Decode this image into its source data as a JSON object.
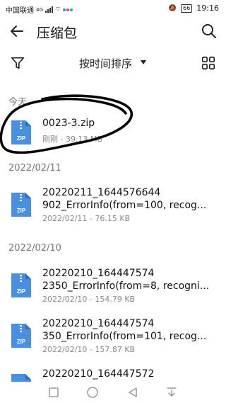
{
  "status_bar": {
    "carrier": "中国联通",
    "network": "4G",
    "battery": "66",
    "time": "19:16"
  },
  "app_bar": {
    "title": "压缩包",
    "back_icon": "back-arrow-icon",
    "search_icon": "search-icon"
  },
  "sort_bar": {
    "sort_label": "按时间排序",
    "filter_icon": "filter-icon",
    "grid_icon": "grid-view-icon"
  },
  "sections": [
    {
      "header": "今天",
      "files": [
        {
          "name_line1": "0023-3.zip",
          "name_line2": "",
          "meta": "刚刚 - 39.13 MB",
          "icon": "zip-file-icon"
        }
      ]
    },
    {
      "header": "2022/02/11",
      "files": [
        {
          "name_line1": "20220211_1644576644",
          "name_line2": "902_ErrorInfo(from=100, recog...",
          "meta": "2022/02/11 - 76.15 KB",
          "icon": "zip-file-icon"
        }
      ]
    },
    {
      "header": "2022/02/10",
      "files": [
        {
          "name_line1": "20220210_164447574",
          "name_line2": "2350_ErrorInfo(from=8, recogni...",
          "meta": "2022/02/10 - 154.79 KB",
          "icon": "zip-file-icon"
        },
        {
          "name_line1": "20220210_164447574",
          "name_line2": "350_ErrorInfo(from=101, recog...",
          "meta": "2022/02/10 - 157.87 KB",
          "icon": "zip-file-icon"
        },
        {
          "name_line1": "20220210_164447572",
          "name_line2": "",
          "meta": "",
          "icon": "zip-file-icon"
        }
      ]
    }
  ],
  "zip_badge": "ZIP",
  "colors": {
    "zip_blue": "#4a90e2",
    "zip_blue_dark": "#2f6fc4",
    "text_secondary": "#8a8a8a"
  },
  "nav_bar": {
    "icons": [
      "square-icon",
      "circle-icon",
      "triangle-back-icon",
      "notification-down-icon"
    ]
  }
}
